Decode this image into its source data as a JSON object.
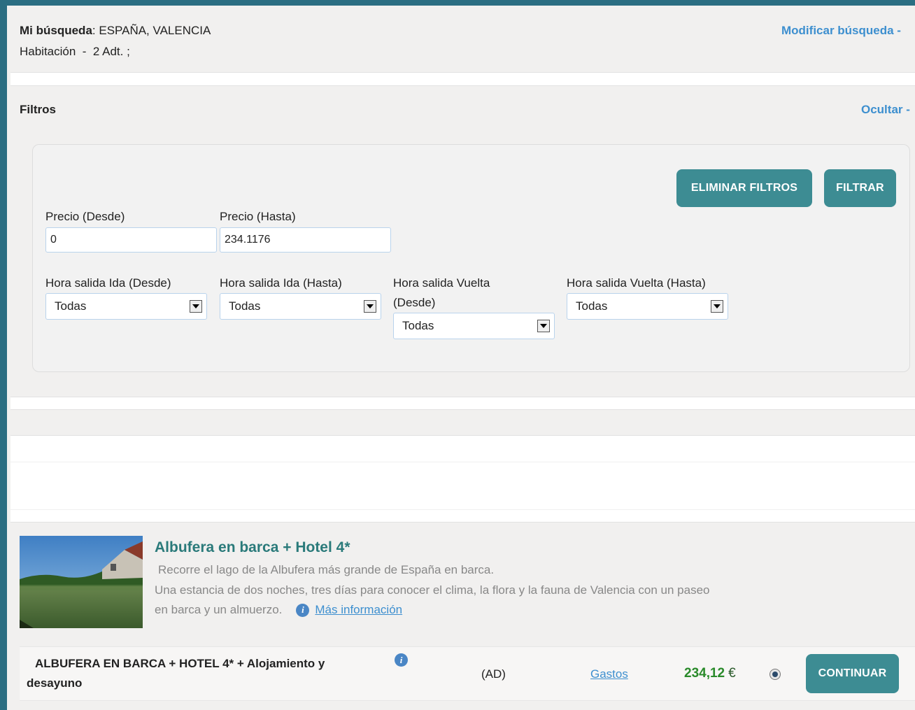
{
  "search": {
    "label": "Mi búsqueda",
    "value": ": ESPAÑA, VALENCIA",
    "rooms": "Habitación  -  2 Adt. ;",
    "modify_link": "Modificar búsqueda"
  },
  "filters": {
    "title": "Filtros",
    "hide_link": "Ocultar",
    "clear_button": "ELIMINAR FILTROS",
    "filter_button": "FILTRAR",
    "price_from_label": "Precio (Desde)",
    "price_from_value": "0",
    "price_to_label": "Precio (Hasta)",
    "price_to_value": "234.1176",
    "dep_out_from_label": "Hora salida Ida (Desde)",
    "dep_out_from_value": "Todas",
    "dep_out_to_label": "Hora salida Ida (Hasta)",
    "dep_out_to_value": "Todas",
    "dep_back_from_label_1": "Hora salida Vuelta",
    "dep_back_from_label_2": "(Desde)",
    "dep_back_from_value": "Todas",
    "dep_back_to_label": "Hora salida Vuelta (Hasta)",
    "dep_back_to_value": "Todas"
  },
  "product": {
    "title": "Albufera en barca + Hotel 4*",
    "desc_line1": "Recorre el lago de la Albufera más grande de España en barca.",
    "desc_line2": "Una estancia de dos noches, tres días para conocer el clima, la flora y la fauna de Valencia con un paseo",
    "desc_line3": "en barca y un almuerzo.",
    "more_info": "Más información",
    "info_icon_glyph": "i"
  },
  "result": {
    "name_line1": "ALBUFERA EN BARCA + HOTEL 4* + Alojamiento y",
    "name_line2": "desayuno",
    "board": "(AD)",
    "fees_link": "Gastos",
    "price": "234,12",
    "currency": "€",
    "continue_button": "CONTINUAR"
  },
  "colors": {
    "accent": "#3d8c93",
    "link": "#3d8fcf",
    "price": "#2a8a2a",
    "title": "#2a7a7a"
  }
}
